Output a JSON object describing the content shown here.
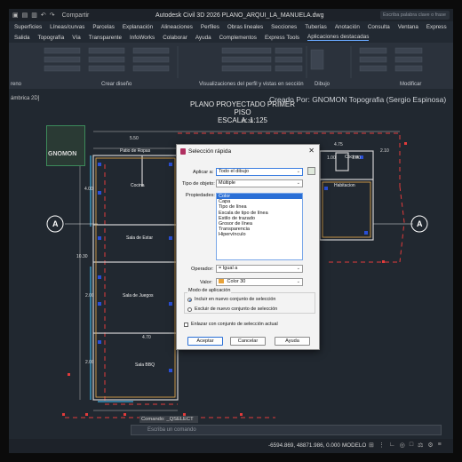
{
  "titlebar": {
    "share_label": "Compartir",
    "title": "Autodesk Civil 3D 2026   PLANO_ARQUI_LA_MANUELA.dwg",
    "search_placeholder": "Escriba palabra clave o frase"
  },
  "menu1": [
    "Superficies",
    "Líneas/curvas",
    "Parcelas",
    "Explanación",
    "Alineaciones",
    "Perfiles",
    "Obras lineales",
    "Secciones",
    "Tuberías",
    "Anotación",
    "Consulta",
    "Ventana",
    "Express"
  ],
  "menu2": [
    "Salida",
    "Topografía",
    "Vía",
    "Transparente",
    "InfoWorks",
    "Colaborar",
    "Ayuda",
    "Complementos",
    "Express Tools",
    "Aplicaciones destacadas"
  ],
  "ribbon": {
    "panels": [
      "Crear diseño",
      "Visualizaciones del perfil y vistas en sección",
      "Dibujo",
      "Modificar"
    ],
    "left_label": "reno"
  },
  "viewport_label": "ámbrica 2D]",
  "credit": "Creado Por: GNOMON Topografia (Sergio Espinosa)",
  "logo_text": "GNOMON",
  "plan": {
    "title": "PLANO PROYECTADO PRIMER PISO",
    "scale": "ESCALA: 1:125",
    "rooms": [
      "Patio de Ropas",
      "Cocina",
      "Sala de Estar",
      "Sala de Juegos",
      "Sala BBQ",
      "Cocina",
      "Habitacion"
    ],
    "dims": [
      "21.30",
      "5.50",
      "4.75",
      "1.00",
      "2.10",
      "1.00",
      "4.00",
      "10.30",
      "2.00",
      "4.70",
      "2.00"
    ],
    "section_marks": [
      "A",
      "A"
    ]
  },
  "dialog": {
    "title": "Selección rápida",
    "apply_label": "Aplicar a:",
    "apply_value": "Todo el dibujo",
    "object_type_label": "Tipo de objeto:",
    "object_type_value": "Múltiple",
    "properties_label": "Propiedades:",
    "properties": [
      "Color",
      "Capa",
      "Tipo de línea",
      "Escala de tipo de línea",
      "Estilo de trazado",
      "Grosor de línea",
      "Transparencia",
      "Hipervínculo"
    ],
    "operator_label": "Operador:",
    "operator_value": "= Igual a",
    "value_label": "Valor:",
    "value_value": "Color 30",
    "mode_title": "Modo de aplicación",
    "mode_include": "Incluir en nuevo conjunto de selección",
    "mode_exclude": "Excluir de nuevo conjunto de selección",
    "append_label": "Enlazar con conjunto de selección actual",
    "ok": "Aceptar",
    "cancel": "Cancelar",
    "help": "Ayuda"
  },
  "command": {
    "history": "Comando: _QSELECT",
    "placeholder": "Escriba un comando"
  },
  "status": {
    "coords": "-6594.869, 48871.986, 0.000",
    "model": "MODELO"
  }
}
